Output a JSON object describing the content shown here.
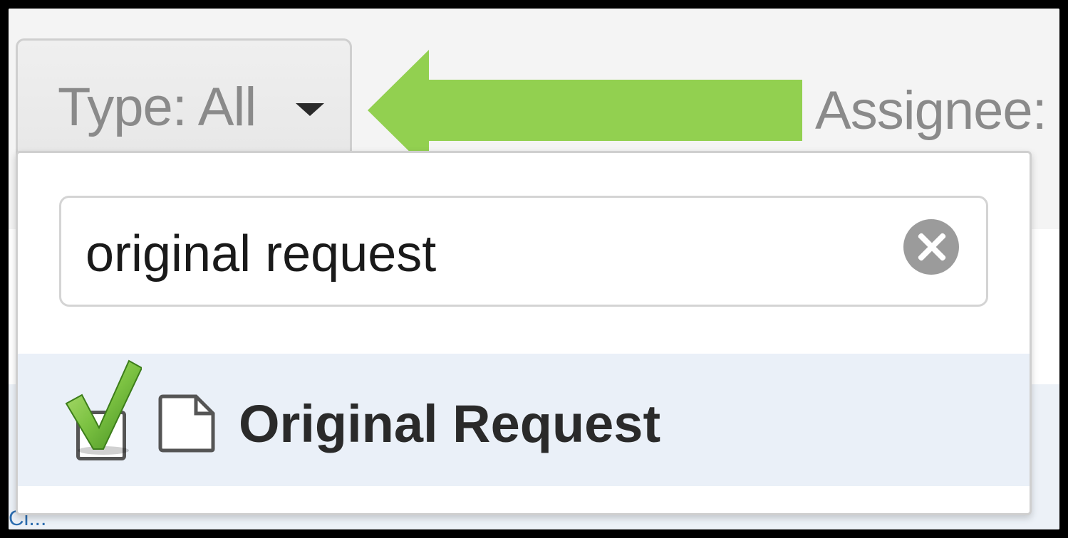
{
  "toolbar": {
    "type_filter_label": "Type: All",
    "assignee_label": "Assignee:"
  },
  "dropdown": {
    "search": {
      "value": "original request",
      "placeholder": ""
    },
    "options": [
      {
        "label": "Original Request",
        "checked": true,
        "icon": "document-icon"
      }
    ]
  },
  "page": {
    "partial_link_text": "Ci..."
  },
  "colors": {
    "annotation_arrow": "#92d050",
    "highlight_row": "#eaf0f8",
    "checkmark": "#7cc242"
  }
}
